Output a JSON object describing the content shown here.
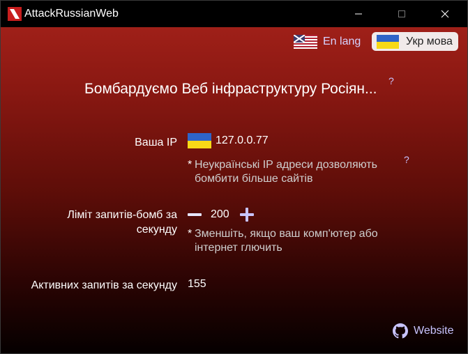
{
  "window": {
    "title": "AttackRussianWeb"
  },
  "lang": {
    "en_label": "En lang",
    "ua_label": "Укр мова"
  },
  "main": {
    "heading": "Бомбардуємо Веб інфраструктуру Росіян...",
    "help": "?",
    "ip": {
      "label": "Ваша IP",
      "value": "127.0.0.77",
      "note_star": "*",
      "note": "Неукраїнські IP адреси дозволяють бомбити більше сайтів",
      "help": "?"
    },
    "limit": {
      "label": "Ліміт запитів-бомб за секунду",
      "value": "200",
      "note_star": "*",
      "note": "Зменшіть, якщо ваш комп'ютер або інтернет глючить"
    },
    "active": {
      "label": "Активних запитів за секунду",
      "value": "155"
    }
  },
  "footer": {
    "website_label": "Website"
  },
  "icons": {
    "app": "app-logo-icon",
    "en_flag": "uk-flag-icon",
    "ua_flag": "ua-flag-icon",
    "github": "github-icon",
    "minus": "minus-icon",
    "plus": "plus-icon"
  },
  "colors": {
    "accent": "#c8c4ff",
    "flag_blue": "#2f64c8",
    "flag_yellow": "#f7d917"
  }
}
